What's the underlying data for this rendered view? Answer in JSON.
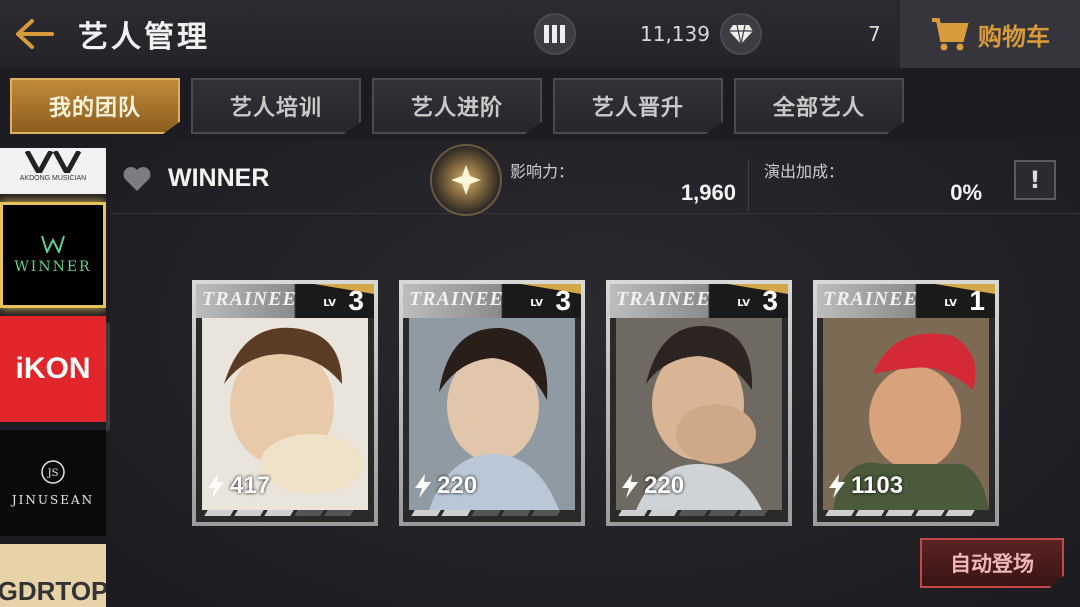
{
  "header": {
    "title": "艺人管理",
    "currency1": {
      "icon": "ticket-icon",
      "value": "11,139"
    },
    "currency2": {
      "icon": "diamond-icon",
      "value": "7"
    },
    "cart_label": "购物车"
  },
  "tabs": [
    {
      "label": "我的团队",
      "active": true
    },
    {
      "label": "艺人培训",
      "active": false
    },
    {
      "label": "艺人进阶",
      "active": false
    },
    {
      "label": "艺人晋升",
      "active": false
    },
    {
      "label": "全部艺人",
      "active": false
    }
  ],
  "sidebar": {
    "groups": [
      {
        "label": "AKDONG MUSICIAN"
      },
      {
        "label": "WINNER",
        "selected": true
      },
      {
        "label": "iKON"
      },
      {
        "label": "JINUSEAN"
      },
      {
        "label": "GDRTOP"
      }
    ]
  },
  "group_info": {
    "name": "WINNER",
    "influence_label": "影响力：",
    "influence_value": "1,960",
    "bonus_label": "演出加成：",
    "bonus_value": "0%",
    "info_button": "!"
  },
  "cards": [
    {
      "rank": "TRAINEE",
      "lv_label": "LV",
      "level": "3",
      "power": "417",
      "pips_filled": 3
    },
    {
      "rank": "TRAINEE",
      "lv_label": "LV",
      "level": "3",
      "power": "220",
      "pips_filled": 2
    },
    {
      "rank": "TRAINEE",
      "lv_label": "LV",
      "level": "3",
      "power": "220",
      "pips_filled": 2
    },
    {
      "rank": "TRAINEE",
      "lv_label": "LV",
      "level": "1",
      "power": "1103",
      "pips_filled": 5
    }
  ],
  "auto_button": "自动登场",
  "colors": {
    "accent_gold": "#c08a3a",
    "auto_red": "#c44848",
    "selected_border": "#e8c35a"
  }
}
